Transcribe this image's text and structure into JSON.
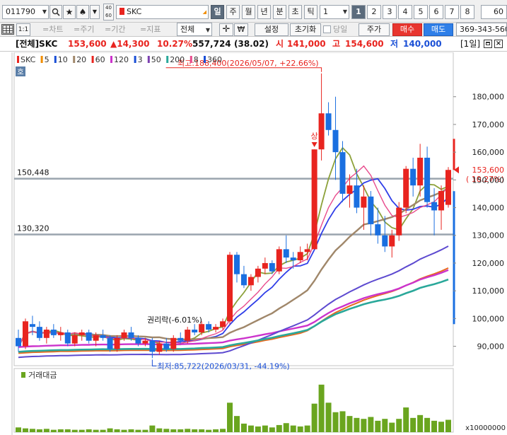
{
  "toolbar": {
    "code": "011790",
    "name": "SKC",
    "period_buttons": [
      "일",
      "주",
      "월",
      "년",
      "분",
      "초",
      "틱"
    ],
    "active_period": "일",
    "period_value": "1",
    "chart_numbers": [
      "1",
      "2",
      "3",
      "4",
      "5",
      "6",
      "7",
      "8"
    ],
    "active_number": "1",
    "right_value": "60"
  },
  "toolbar2": {
    "ratio": "1:1",
    "tools": [
      "=차트",
      "=주기",
      "=기간",
      "=지표"
    ],
    "scope": "전체",
    "settings": "설정",
    "reset": "초기화",
    "same_day": "당일",
    "price_add": "주가",
    "buy": "매수",
    "sell": "매도",
    "account": "369-343-560"
  },
  "info": {
    "scope": "[전체]SKC",
    "price": "153,600",
    "change": "▲14,300",
    "change_pct": "10.27%",
    "volume": "557,724",
    "volume_ratio": "(38.02)",
    "open_label": "시",
    "open": "141,000",
    "high_label": "고",
    "high": "154,600",
    "low_label": "저",
    "low": "140,000",
    "period_tag": "[1일]"
  },
  "chart_data": {
    "type": "candlestick",
    "legend": [
      {
        "label": "SKC",
        "color": "#e8241f"
      },
      {
        "label": "5",
        "color": "#f08c00"
      },
      {
        "label": "10",
        "color": "#1a4fd6"
      },
      {
        "label": "20",
        "color": "#a0876a"
      },
      {
        "label": "60",
        "color": "#e8241f"
      },
      {
        "label": "120",
        "color": "#cc33cc"
      },
      {
        "label": "3",
        "color": "#1a4fd6"
      },
      {
        "label": "50",
        "color": "#7b3fb0"
      },
      {
        "label": "200",
        "color": "#2aa89a"
      },
      {
        "label": "8",
        "color": "#e84a8c"
      },
      {
        "label": "360",
        "color": "#1a4fd6"
      }
    ],
    "badge": "호",
    "ylim": [
      83000,
      196000
    ],
    "y_ticks": [
      180000,
      170000,
      160000,
      150000,
      140000,
      130000,
      120000,
      110000,
      100000,
      90000
    ],
    "hlines": [
      {
        "value": 150448,
        "label": "150,448"
      },
      {
        "value": 130320,
        "label": "130,320"
      }
    ],
    "max_annotation": "최고:188,400(2026/05/07, +22.66%)",
    "min_annotation": "최저:85,722(2026/03/31, -44.19%)",
    "rights_annotation": "권리락(-6.01%)",
    "limit_up_label": "상",
    "current_price_label": "153,600",
    "current_pct_label": "( 10.27%)",
    "candles": [
      [
        93000,
        96000,
        88000,
        90000
      ],
      [
        90000,
        100000,
        89000,
        99000
      ],
      [
        98000,
        101000,
        94000,
        97000
      ],
      [
        97000,
        99000,
        92000,
        93000
      ],
      [
        93000,
        97000,
        91000,
        96000
      ],
      [
        96000,
        98000,
        93000,
        94000
      ],
      [
        94000,
        97000,
        92000,
        95000
      ],
      [
        95000,
        96000,
        90000,
        91000
      ],
      [
        91000,
        95000,
        90000,
        94000
      ],
      [
        94000,
        96000,
        92000,
        95000
      ],
      [
        95000,
        96000,
        91000,
        92000
      ],
      [
        92000,
        95000,
        90000,
        94000
      ],
      [
        94000,
        96000,
        92000,
        93000
      ],
      [
        93000,
        94000,
        88000,
        89000
      ],
      [
        89000,
        94000,
        88000,
        93000
      ],
      [
        93000,
        96000,
        92000,
        95000
      ],
      [
        95000,
        97000,
        92000,
        93000
      ],
      [
        93000,
        94000,
        90000,
        91000
      ],
      [
        91000,
        93000,
        90000,
        92000
      ],
      [
        92000,
        93000,
        85722,
        88000
      ],
      [
        88000,
        92000,
        87000,
        91000
      ],
      [
        91000,
        93000,
        88000,
        89000
      ],
      [
        89000,
        94000,
        88000,
        93000
      ],
      [
        93000,
        95000,
        91000,
        92000
      ],
      [
        92000,
        97000,
        91000,
        96000
      ],
      [
        96000,
        98000,
        94000,
        95000
      ],
      [
        95000,
        99000,
        94000,
        98000
      ],
      [
        98000,
        99000,
        95000,
        96000
      ],
      [
        96000,
        98000,
        95000,
        97000
      ],
      [
        97000,
        100000,
        96000,
        99000
      ],
      [
        99000,
        124000,
        98000,
        123000
      ],
      [
        123000,
        124000,
        113000,
        116000
      ],
      [
        116000,
        119000,
        111000,
        112000
      ],
      [
        112000,
        116000,
        110000,
        115000
      ],
      [
        115000,
        119000,
        113000,
        118000
      ],
      [
        118000,
        122000,
        116000,
        120000
      ],
      [
        120000,
        121000,
        116000,
        117000
      ],
      [
        117000,
        126000,
        116000,
        125000
      ],
      [
        125000,
        130000,
        120000,
        122000
      ],
      [
        122000,
        124000,
        118000,
        121000
      ],
      [
        121000,
        126000,
        120000,
        124000
      ],
      [
        124000,
        127000,
        121000,
        125000
      ],
      [
        125000,
        161000,
        125000,
        161000
      ],
      [
        161000,
        188400,
        157000,
        174000
      ],
      [
        174000,
        178000,
        166000,
        168000
      ],
      [
        168000,
        180000,
        150000,
        160000
      ],
      [
        160000,
        164000,
        142000,
        145000
      ],
      [
        145000,
        152000,
        140000,
        148000
      ],
      [
        148000,
        154000,
        138000,
        140000
      ],
      [
        140000,
        148000,
        132000,
        144000
      ],
      [
        144000,
        146000,
        130000,
        134000
      ],
      [
        134000,
        140000,
        127000,
        130000
      ],
      [
        130000,
        137000,
        124000,
        126000
      ],
      [
        126000,
        132000,
        122000,
        130000
      ],
      [
        130000,
        142000,
        128000,
        140000
      ],
      [
        140000,
        155000,
        138000,
        154000
      ],
      [
        154000,
        158000,
        144000,
        148000
      ],
      [
        148000,
        163000,
        144000,
        158000
      ],
      [
        158000,
        162000,
        140000,
        142000
      ],
      [
        142000,
        147000,
        130000,
        139000
      ],
      [
        139000,
        148000,
        132000,
        146000
      ],
      [
        141000,
        154600,
        140000,
        153600
      ]
    ],
    "volume_title": "거래대금",
    "volume_ticks": [
      100000
    ],
    "volume_unit": "x10000000",
    "volume": [
      10,
      8,
      7,
      6,
      7,
      5,
      6,
      6,
      5,
      5,
      6,
      5,
      5,
      8,
      6,
      5,
      6,
      5,
      5,
      14,
      8,
      7,
      6,
      6,
      7,
      6,
      6,
      5,
      6,
      7,
      62,
      34,
      18,
      14,
      12,
      14,
      10,
      15,
      19,
      14,
      12,
      14,
      60,
      100,
      62,
      42,
      44,
      34,
      30,
      28,
      32,
      24,
      28,
      20,
      28,
      52,
      30,
      36,
      30,
      24,
      22,
      26
    ]
  }
}
